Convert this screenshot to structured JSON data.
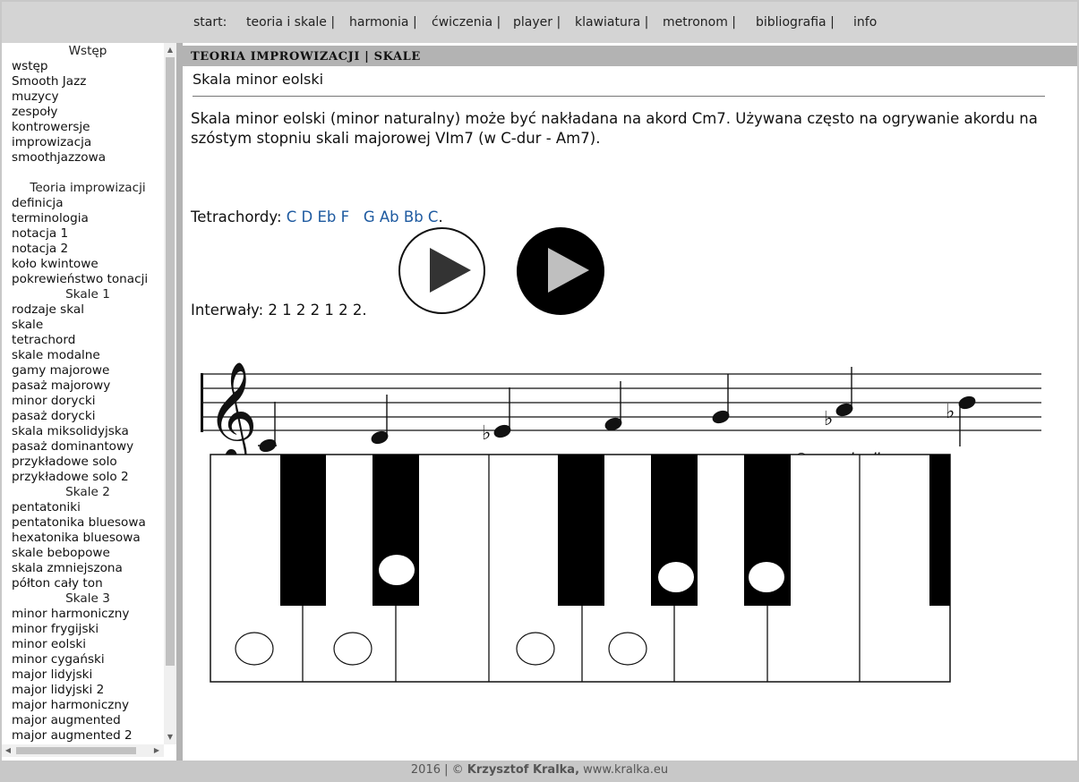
{
  "nav": {
    "start": "start:",
    "items": [
      "teoria i skale |",
      "harmonia |",
      "ćwiczenia |",
      "player |",
      "klawiatura |",
      "metronom |",
      "bibliografia |",
      "info"
    ]
  },
  "sidebar": {
    "intro_heading": "Wstęp",
    "intro_items": [
      "wstęp",
      "Smooth Jazz",
      "muzycy",
      "zespoły",
      "kontrowersje",
      "improwizacja",
      "smoothjazzowa"
    ],
    "theory_heading": "Teoria improwizacji",
    "theory_items": [
      "definicja",
      "terminologia",
      "notacja 1",
      "notacja 2",
      "koło kwintowe",
      "pokrewieństwo tonacji"
    ],
    "scales1_heading": "Skale 1",
    "scales1_items": [
      "rodzaje skal",
      "skale",
      "tetrachord",
      "skale modalne",
      "gamy majorowe",
      "pasaż majorowy",
      "minor dorycki",
      "pasaż dorycki",
      "skala miksolidyjska",
      "pasaż dominantowy",
      "przykładowe solo",
      "przykładowe solo 2"
    ],
    "scales2_heading": "Skale 2",
    "scales2_items": [
      "pentatoniki",
      "pentatonika bluesowa",
      "hexatonika bluesowa",
      "skale bebopowe",
      "skala zmniejszona",
      "półton cały ton"
    ],
    "scales3_heading": "Skale 3",
    "scales3_items": [
      "minor harmoniczny",
      "minor frygijski",
      "minor eolski",
      "minor cygański",
      "major lidyjski",
      "major lidyjski 2",
      "major harmoniczny",
      "major augmented",
      "major augmented 2"
    ]
  },
  "main": {
    "section": "TEORIA IMPROWIZACJI | SKALE",
    "title": "Skala minor eolski",
    "description": "Skala minor eolski (minor naturalny) może być nakładana na akord Cm7. Używana często na ogrywanie akordu na szóstym stopniu skali majorowej VIm7 (w C-dur - Am7).",
    "tetra_label": "Tetrachordy:",
    "tetra_notes": "C D Eb F   G Ab Bb C",
    "tetra_end": ".",
    "intervals": "Interwały: 2 1 2 2 1 2 2.",
    "copyright": "© www.kralka.eu"
  },
  "footer": {
    "year": "2016 | © ",
    "author": "Krzysztof Kralka,",
    "site": " www.kralka.eu"
  },
  "icons": {
    "play_outline": "play-icon",
    "play_filled": "play-icon",
    "treble_clef": "treble-clef-icon",
    "flat": "flat-icon"
  }
}
